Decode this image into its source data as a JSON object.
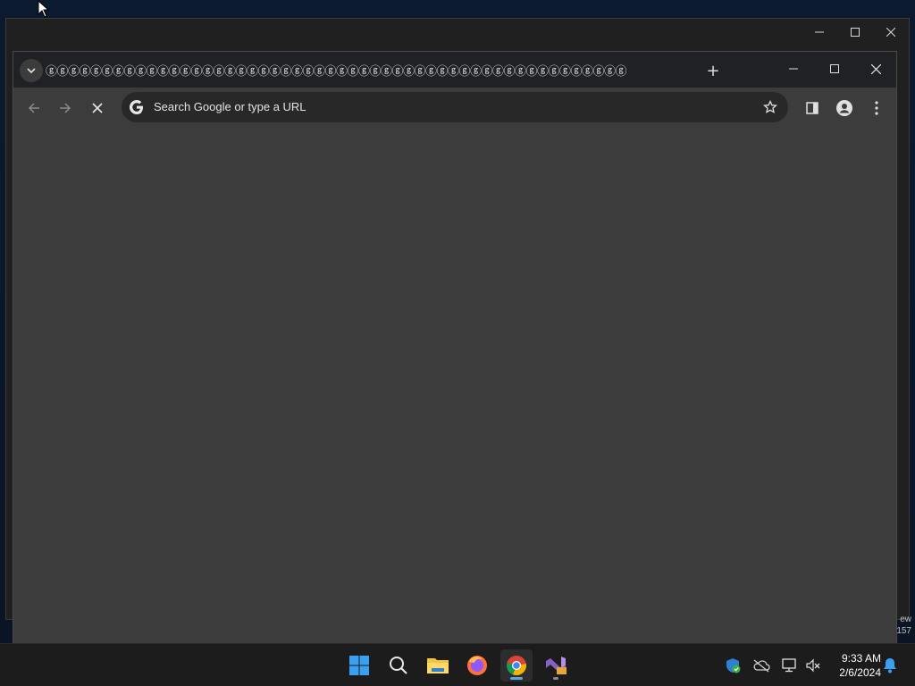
{
  "browser": {
    "tab_title": "ⓖⓖⓖⓖⓖⓖⓖⓖⓖⓖⓖⓖⓖⓖⓖⓖⓖⓖⓖⓖⓖⓖⓖⓖⓖⓖⓖⓖⓖⓖⓖⓖⓖⓖⓖⓖⓖⓖⓖⓖⓖⓖⓖⓖⓖⓖⓖⓖⓖⓖⓖⓖ",
    "omnibox_placeholder": "Search Google or type a URL",
    "new_tab_label": "+"
  },
  "outer_window": {
    "edge_fragment_1": "ew",
    "edge_fragment_2": "157"
  },
  "taskbar": {
    "apps": [
      "start-windows-icon",
      "search-icon",
      "file-explorer-icon",
      "firefox-icon",
      "chrome-icon",
      "visual-studio-icon"
    ],
    "active_app": "chrome-icon"
  },
  "tray": {
    "time": "9:33 AM",
    "date": "2/6/2024"
  },
  "colors": {
    "chrome_toolbar": "#3c3c3c",
    "tabstrip": "#202124",
    "taskbar": "#1c1c1c",
    "accent": "#5aa5e8"
  }
}
